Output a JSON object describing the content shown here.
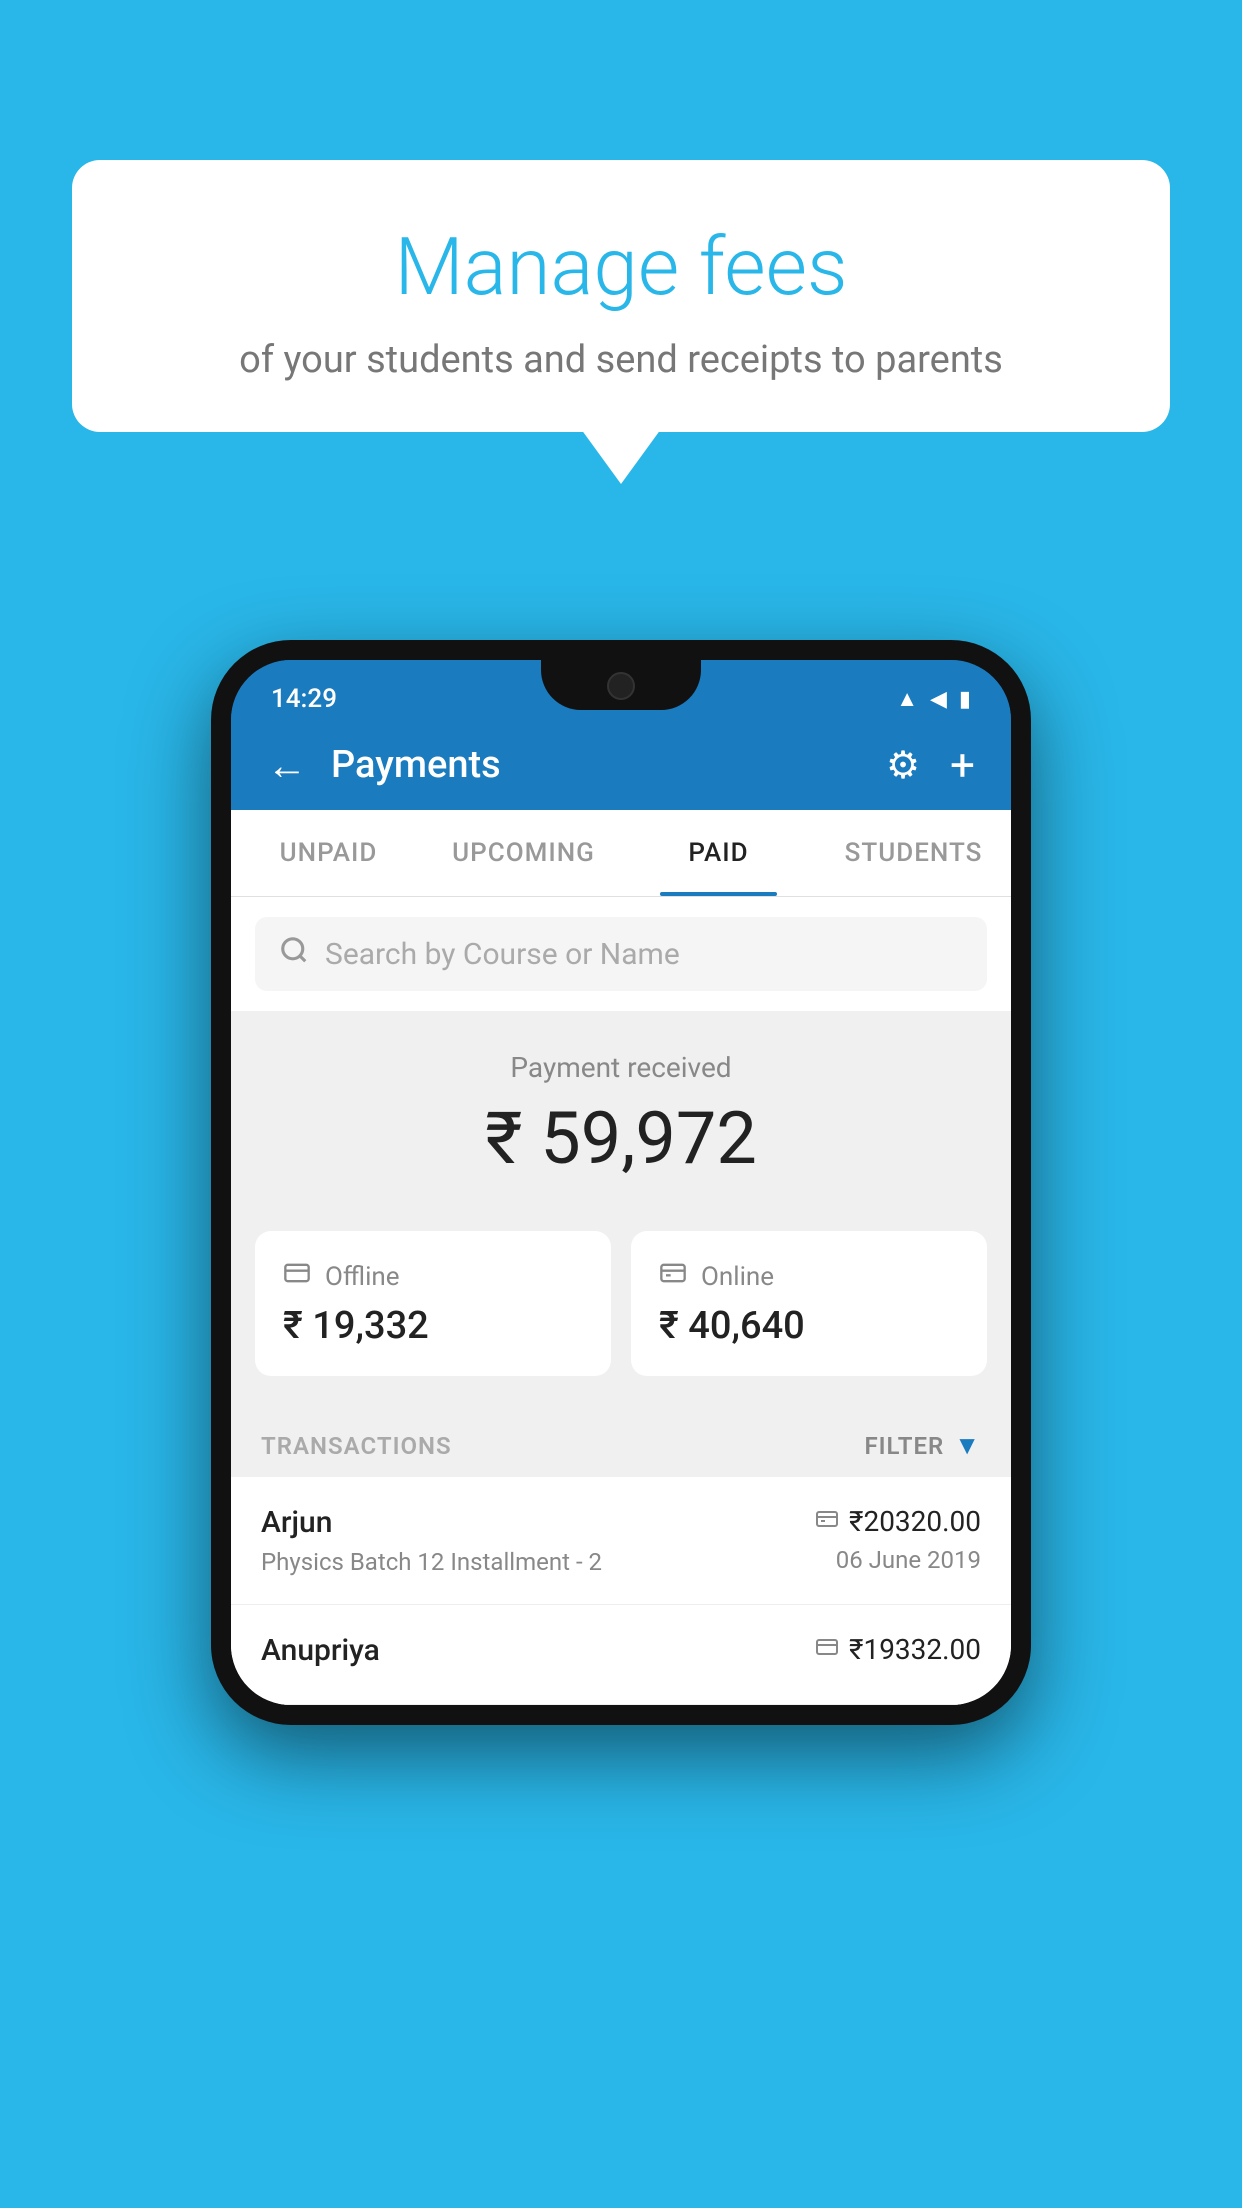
{
  "background_color": "#29b6e8",
  "bubble": {
    "title": "Manage fees",
    "subtitle": "of your students and send receipts to parents"
  },
  "status_bar": {
    "time": "14:29",
    "wifi_icon": "▲",
    "signal_icon": "▲",
    "battery_icon": "▮"
  },
  "app_bar": {
    "title": "Payments",
    "back_icon": "←",
    "gear_icon": "⚙",
    "plus_icon": "+"
  },
  "tabs": [
    {
      "label": "UNPAID",
      "active": false
    },
    {
      "label": "UPCOMING",
      "active": false
    },
    {
      "label": "PAID",
      "active": true
    },
    {
      "label": "STUDENTS",
      "active": false
    }
  ],
  "search": {
    "placeholder": "Search by Course or Name"
  },
  "payment": {
    "label": "Payment received",
    "total": "₹ 59,972",
    "offline_label": "Offline",
    "offline_amount": "₹ 19,332",
    "online_label": "Online",
    "online_amount": "₹ 40,640"
  },
  "transactions": {
    "header_label": "TRANSACTIONS",
    "filter_label": "FILTER"
  },
  "transaction_list": [
    {
      "name": "Arjun",
      "course": "Physics Batch 12 Installment - 2",
      "icon": "💳",
      "amount": "₹20320.00",
      "date": "06 June 2019"
    },
    {
      "name": "Anupriya",
      "course": "",
      "icon": "🏦",
      "amount": "₹19332.00",
      "date": ""
    }
  ]
}
